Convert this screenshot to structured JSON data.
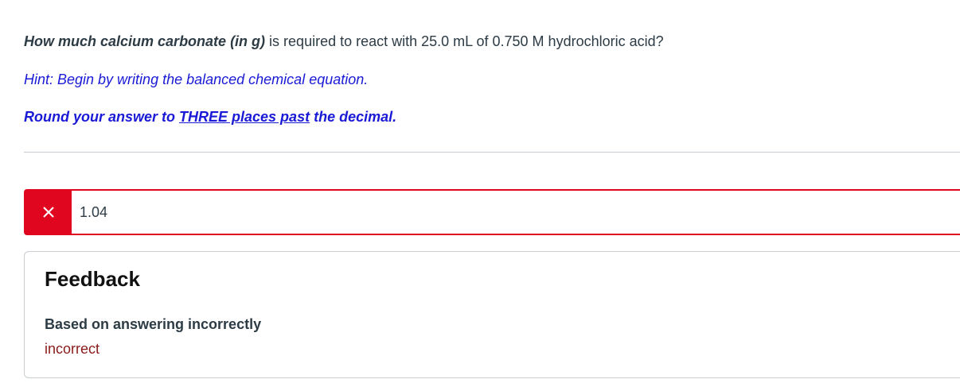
{
  "question": {
    "lead_bold_italic": "How much calcium carbonate (in g)",
    "rest": " is required to react with 25.0 mL of 0.750 M hydrochloric acid?"
  },
  "hint": "Hint: Begin by writing the balanced chemical equation.",
  "rounding": {
    "part1": "Round your answer to ",
    "link": "THREE places past",
    "part2": " the decimal."
  },
  "answer": {
    "value": "1.04",
    "status_icon": "x-icon",
    "status_color": "#e0061f",
    "correct": false
  },
  "feedback": {
    "title": "Feedback",
    "reason": "Based on answering incorrectly",
    "status": "incorrect",
    "status_color": "#8b1a1a"
  },
  "colors": {
    "text": "#2d3b45",
    "hint_blue": "#1a1ad6",
    "error_red": "#e0061f",
    "border_gray": "#c7cdd1"
  }
}
